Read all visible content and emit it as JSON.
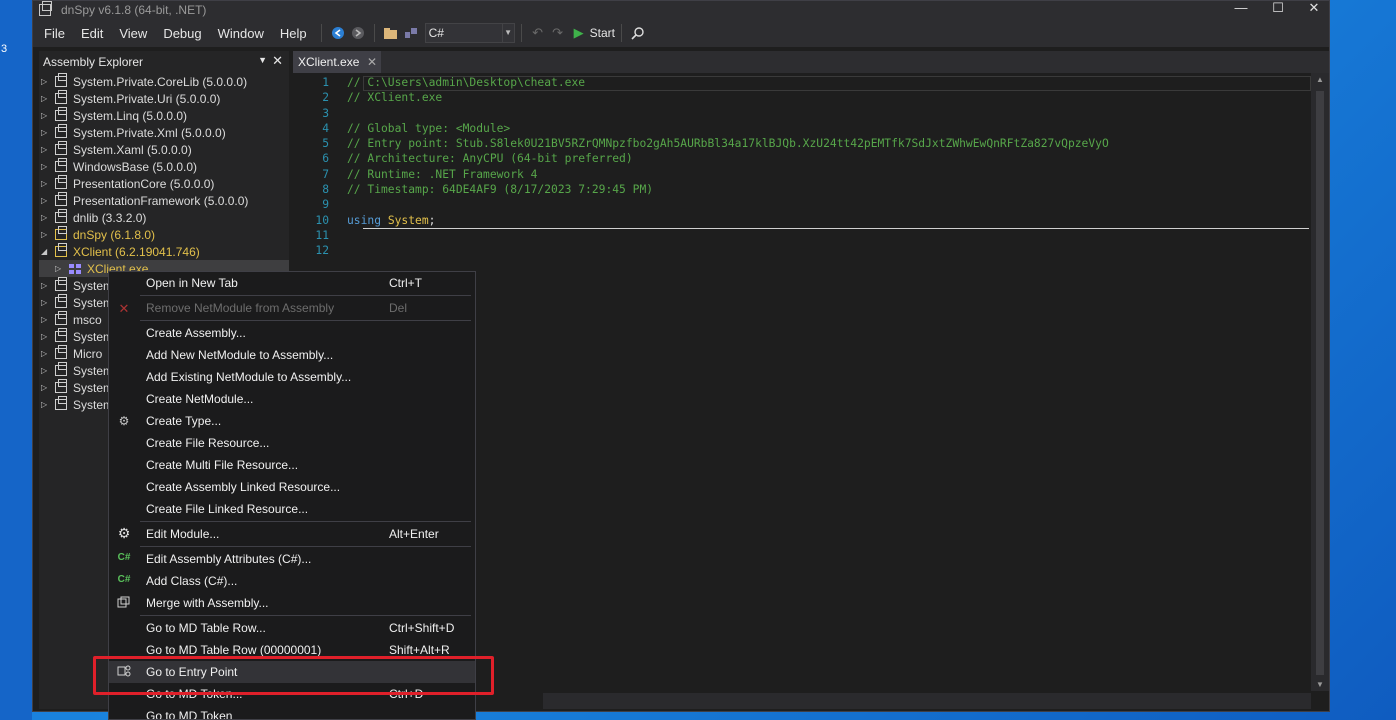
{
  "desktop": {
    "edge_text": "3"
  },
  "window": {
    "title": "dnSpy v6.1.8 (64-bit, .NET)"
  },
  "menubar": {
    "items": [
      "File",
      "Edit",
      "View",
      "Debug",
      "Window",
      "Help"
    ],
    "language": "C#",
    "start_label": "Start"
  },
  "explorer": {
    "title": "Assembly Explorer",
    "items": [
      {
        "label": "System.Private.CoreLib (5.0.0.0)"
      },
      {
        "label": "System.Private.Uri (5.0.0.0)"
      },
      {
        "label": "System.Linq (5.0.0.0)"
      },
      {
        "label": "System.Private.Xml (5.0.0.0)"
      },
      {
        "label": "System.Xaml (5.0.0.0)"
      },
      {
        "label": "WindowsBase (5.0.0.0)"
      },
      {
        "label": "PresentationCore (5.0.0.0)"
      },
      {
        "label": "PresentationFramework (5.0.0.0)"
      },
      {
        "label": "dnlib (3.3.2.0)"
      },
      {
        "label": "dnSpy (6.1.8.0)"
      },
      {
        "label": "XClient (6.2.19041.746)"
      },
      {
        "label": "XClient.exe"
      },
      {
        "label": "System"
      },
      {
        "label": "System"
      },
      {
        "label": "msco"
      },
      {
        "label": "System"
      },
      {
        "label": "Micro"
      },
      {
        "label": "System"
      },
      {
        "label": "System"
      },
      {
        "label": "System"
      }
    ]
  },
  "tab": {
    "label": "XClient.exe"
  },
  "code": {
    "lines": [
      {
        "n": "1",
        "text": "// C:\\Users\\admin\\Desktop\\cheat.exe"
      },
      {
        "n": "2",
        "text": "// XClient.exe"
      },
      {
        "n": "3",
        "text": ""
      },
      {
        "n": "4",
        "text": "// Global type: <Module>"
      },
      {
        "n": "5",
        "text": "// Entry point: Stub.S8lek0U21BV5RZrQMNpzfbo2gAh5AURbBl34a17klBJQb.XzU24tt42pEMTfk7SdJxtZWhwEwQnRFtZa827vQpzeVyO"
      },
      {
        "n": "6",
        "text": "// Architecture: AnyCPU (64-bit preferred)"
      },
      {
        "n": "7",
        "text": "// Runtime: .NET Framework 4"
      },
      {
        "n": "8",
        "text": "// Timestamp: 64DE4AF9 (8/17/2023 7:29:45 PM)"
      },
      {
        "n": "9",
        "text": ""
      },
      {
        "n": "10",
        "kw": "using",
        "type": "System",
        "punct": ";"
      },
      {
        "n": "11",
        "text": ""
      },
      {
        "n": "12",
        "text": ""
      }
    ]
  },
  "context_menu": {
    "items": [
      {
        "label": "Open in New Tab",
        "shortcut": "Ctrl+T"
      },
      {
        "label": "Remove NetModule from Assembly",
        "shortcut": "Del"
      },
      {
        "label": "Create Assembly..."
      },
      {
        "label": "Add New NetModule to Assembly..."
      },
      {
        "label": "Add Existing NetModule to Assembly..."
      },
      {
        "label": "Create NetModule..."
      },
      {
        "label": "Create Type..."
      },
      {
        "label": "Create File Resource..."
      },
      {
        "label": "Create Multi File Resource..."
      },
      {
        "label": "Create Assembly Linked Resource..."
      },
      {
        "label": "Create File Linked Resource..."
      },
      {
        "label": "Edit Module...",
        "shortcut": "Alt+Enter"
      },
      {
        "label": "Edit Assembly Attributes (C#)...",
        "icon_text": "C#"
      },
      {
        "label": "Add Class (C#)...",
        "icon_text": "C#"
      },
      {
        "label": "Merge with Assembly..."
      },
      {
        "label": "Go to MD Table Row...",
        "shortcut": "Ctrl+Shift+D"
      },
      {
        "label": "Go to MD Table Row (00000001)",
        "shortcut": "Shift+Alt+R"
      },
      {
        "label": "Go to Entry Point"
      },
      {
        "label": "Go to MD Token...",
        "shortcut": "Ctrl+D"
      },
      {
        "label": "Go to MD Token"
      }
    ]
  },
  "colors": {
    "accent_highlight": "#e0202a",
    "comment": "#57a64a",
    "keyword": "#569cd6",
    "type": "#e2c04b",
    "line_number": "#2b91af",
    "background": "#1e1e1e"
  }
}
